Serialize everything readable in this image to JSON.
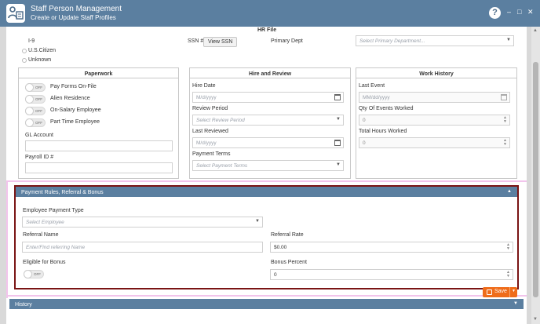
{
  "window": {
    "title": "Staff Person Management",
    "subtitle": "Create or Update Staff Profiles",
    "help_label": "?",
    "minimize": "–",
    "maximize": "□",
    "close": "✕"
  },
  "hr_file": {
    "heading": "HR File",
    "i9_label": "I-9",
    "citizenship_options": [
      "U.S.Citizen",
      "Unknown"
    ],
    "ssn_label": "SSN #",
    "view_ssn_button": "View SSN",
    "primary_dept_label": "Primary Dept",
    "primary_dept_placeholder": "Select Primary Department..."
  },
  "paperwork": {
    "title": "Paperwork",
    "toggles": [
      {
        "label": "Pay Forms On-File",
        "state": "OFF"
      },
      {
        "label": "Alien Residence",
        "state": "OFF"
      },
      {
        "label": "On-Salary Employee",
        "state": "OFF"
      },
      {
        "label": "Part Time Employee",
        "state": "OFF"
      }
    ],
    "gl_account_label": "GL Account",
    "gl_account_value": "",
    "payroll_id_label": "Payroll ID #",
    "payroll_id_value": ""
  },
  "hire_review": {
    "title": "Hire and Review",
    "hire_date_label": "Hire Date",
    "hire_date_placeholder": "M/d/yyyy",
    "review_period_label": "Review Period",
    "review_period_placeholder": "Select Review Period",
    "last_reviewed_label": "Last Reviewed",
    "last_reviewed_placeholder": "M/d/yyyy",
    "payment_terms_label": "Payment Terms",
    "payment_terms_placeholder": "Select Payment Terms"
  },
  "work_history": {
    "title": "Work History",
    "last_event_label": "Last Event",
    "last_event_placeholder": "MM/dd/yyyy",
    "qty_events_label": "Qty Of Events Worked",
    "qty_events_value": "0",
    "total_hours_label": "Total Hours Worked",
    "total_hours_value": "0"
  },
  "payment_rules": {
    "title": "Payment Rules, Referral & Bonus",
    "employee_payment_type_label": "Employee Payment Type",
    "employee_payment_type_placeholder": "Select Employee",
    "referral_name_label": "Referral Name",
    "referral_name_placeholder": "Enter/Find referring Name",
    "referral_rate_label": "Referral Rate",
    "referral_rate_value": "$0.00",
    "eligible_bonus_label": "Eligible for Bonus",
    "eligible_bonus_state": "OFF",
    "bonus_percent_label": "Bonus Percent",
    "bonus_percent_value": "0"
  },
  "history": {
    "title": "History"
  },
  "footer": {
    "save_label": "Save"
  }
}
